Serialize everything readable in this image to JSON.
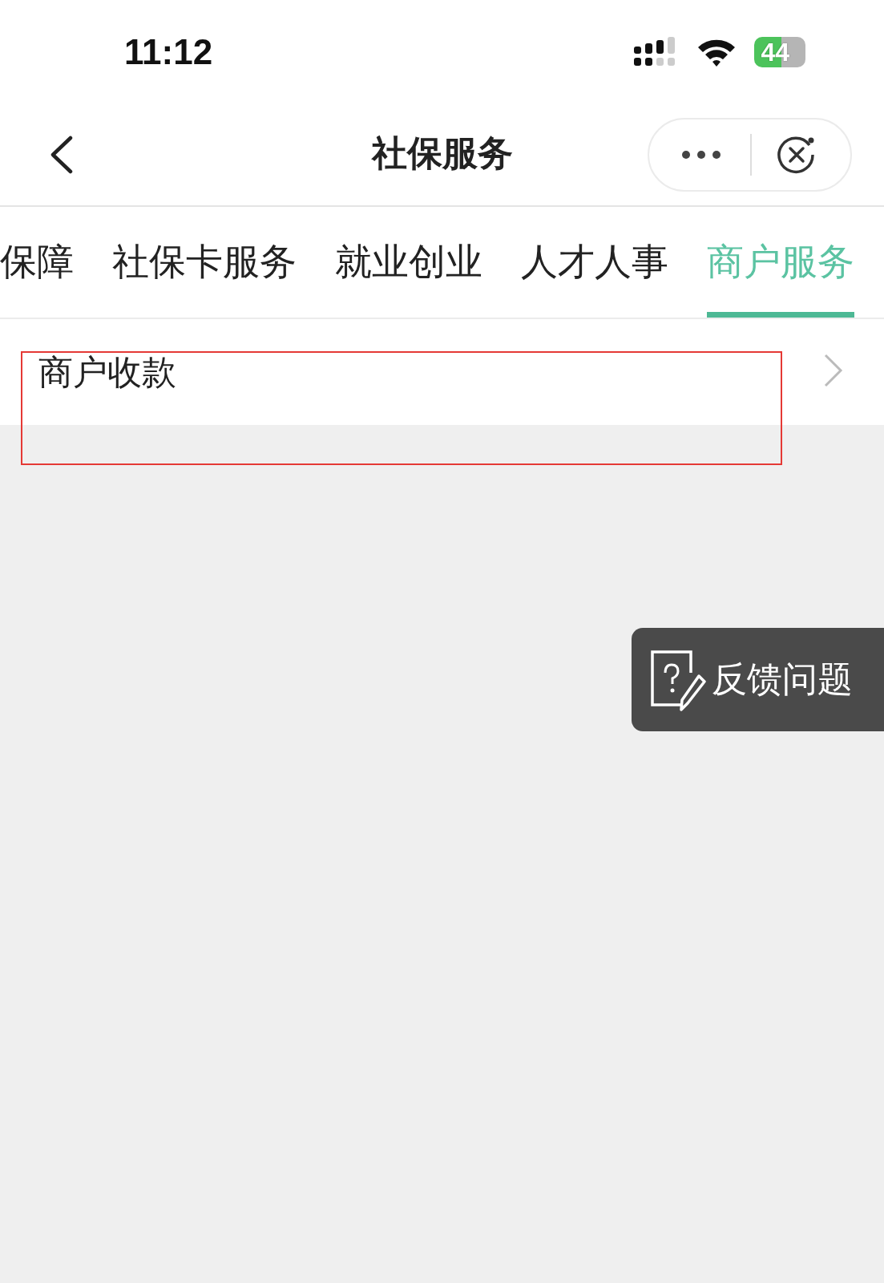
{
  "status_bar": {
    "time": "11:12",
    "battery": "44"
  },
  "nav": {
    "title": "社保服务"
  },
  "tabs": [
    {
      "label": "保障",
      "selected": false
    },
    {
      "label": "社保卡服务",
      "selected": false
    },
    {
      "label": "就业创业",
      "selected": false
    },
    {
      "label": "人才人事",
      "selected": false
    },
    {
      "label": "商户服务",
      "selected": true
    }
  ],
  "items": [
    {
      "label": "商户收款",
      "highlighted": true
    }
  ],
  "feedback_button": {
    "label": "反馈问题"
  }
}
